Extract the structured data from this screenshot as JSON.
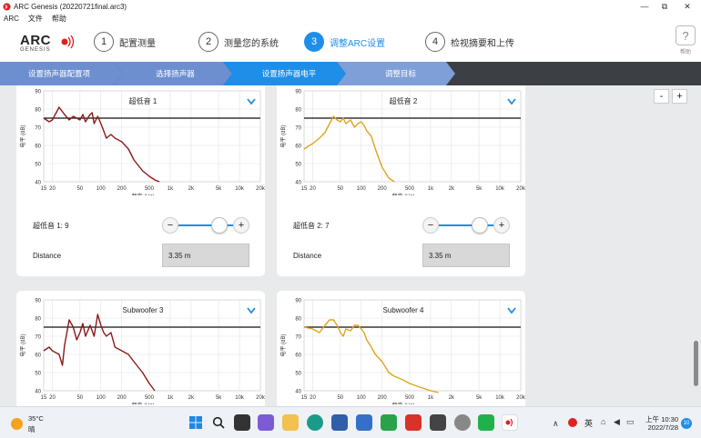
{
  "window": {
    "title": "ARC Genesis (20220721final.arc3)",
    "min": "—",
    "max": "⧉",
    "close": "✕"
  },
  "menu": [
    "ARC",
    "文件",
    "帮助"
  ],
  "logo": {
    "top": "ARC",
    "bottom": "GENESIS"
  },
  "steps": [
    {
      "num": "1",
      "label": "配置测量"
    },
    {
      "num": "2",
      "label": "测量您的系统"
    },
    {
      "num": "3",
      "label": "调整ARC设置"
    },
    {
      "num": "4",
      "label": "检视摘要和上传"
    }
  ],
  "help": {
    "icon": "?",
    "label": "帮助"
  },
  "substeps": [
    "设置扬声器配置项",
    "选择扬声器",
    "设置扬声器电平",
    "调整目标"
  ],
  "zoom": {
    "minus": "-",
    "plus": "+"
  },
  "axis": {
    "ylabel": "电平 (dB)",
    "xlabel": "频率 (Hz)",
    "yticks": [
      "90",
      "80",
      "70",
      "60",
      "50",
      "40"
    ],
    "xticks": [
      "15",
      "20",
      "50",
      "100",
      "200",
      "500",
      "1k",
      "2k",
      "5k",
      "10k",
      "20k"
    ]
  },
  "cards": [
    {
      "title": "超低音 1",
      "slider_label": "超低音 1: 9",
      "distance_label": "Distance",
      "distance_value": "3.35 m"
    },
    {
      "title": "超低音 2",
      "slider_label": "超低音 2: 7",
      "distance_label": "Distance",
      "distance_value": "3.35 m"
    },
    {
      "title": "Subwoofer 3"
    },
    {
      "title": "Subwoofer 4"
    }
  ],
  "slider": {
    "minus": "−",
    "plus": "+"
  },
  "chart_data": [
    {
      "type": "line",
      "title": "超低音 1",
      "xlabel": "频率 (Hz)",
      "ylabel": "电平 (dB)",
      "x_scale": "log",
      "xlim": [
        15,
        20000
      ],
      "ylim": [
        40,
        90
      ],
      "target_level": 75,
      "color": "#8b1a1a",
      "series": [
        {
          "x": [
            15,
            18,
            20,
            25,
            30,
            35,
            40,
            45,
            50,
            55,
            60,
            70,
            75,
            80,
            90,
            100,
            110,
            120,
            140,
            160,
            200,
            250,
            300,
            400,
            500,
            600,
            700
          ],
          "y": [
            75,
            73,
            74,
            81,
            77,
            74,
            76,
            75,
            74,
            77,
            73,
            77,
            78,
            72,
            76,
            72,
            68,
            64,
            66,
            64,
            62,
            58,
            52,
            46,
            43,
            41,
            40
          ]
        }
      ]
    },
    {
      "type": "line",
      "title": "超低音 2",
      "xlabel": "频率 (Hz)",
      "ylabel": "电平 (dB)",
      "x_scale": "log",
      "xlim": [
        15,
        20000
      ],
      "ylim": [
        40,
        90
      ],
      "target_level": 75,
      "color": "#e0a41c",
      "series": [
        {
          "x": [
            15,
            18,
            20,
            25,
            30,
            35,
            40,
            45,
            50,
            55,
            60,
            70,
            80,
            90,
            100,
            110,
            120,
            140,
            160,
            200,
            250,
            300
          ],
          "y": [
            58,
            60,
            61,
            64,
            67,
            72,
            76,
            74,
            73,
            75,
            72,
            74,
            70,
            72,
            73,
            71,
            68,
            65,
            58,
            48,
            42,
            40
          ]
        }
      ]
    },
    {
      "type": "line",
      "title": "Subwoofer 3",
      "xlabel": "频率 (Hz)",
      "ylabel": "电平 (dB)",
      "x_scale": "log",
      "xlim": [
        15,
        20000
      ],
      "ylim": [
        40,
        90
      ],
      "target_level": 75,
      "color": "#8b1a1a",
      "series": [
        {
          "x": [
            15,
            18,
            20,
            25,
            28,
            30,
            35,
            40,
            45,
            50,
            55,
            60,
            70,
            80,
            90,
            100,
            110,
            120,
            140,
            160,
            200,
            250,
            300,
            400,
            500,
            600
          ],
          "y": [
            62,
            64,
            62,
            60,
            54,
            65,
            79,
            75,
            68,
            72,
            77,
            70,
            76,
            70,
            82,
            76,
            72,
            70,
            72,
            64,
            62,
            60,
            56,
            50,
            44,
            40
          ]
        }
      ]
    },
    {
      "type": "line",
      "title": "Subwoofer 4",
      "xlabel": "频率 (Hz)",
      "ylabel": "电平 (dB)",
      "x_scale": "log",
      "xlim": [
        15,
        20000
      ],
      "ylim": [
        40,
        90
      ],
      "target_level": 75,
      "color": "#e0a41c",
      "series": [
        {
          "x": [
            15,
            20,
            25,
            30,
            35,
            40,
            45,
            50,
            55,
            60,
            70,
            80,
            90,
            100,
            110,
            120,
            140,
            160,
            200,
            250,
            300,
            400,
            500,
            700,
            1000,
            1300
          ],
          "y": [
            75,
            74,
            72,
            76,
            79,
            79,
            76,
            72,
            70,
            74,
            73,
            76,
            76,
            74,
            72,
            68,
            64,
            60,
            56,
            50,
            48,
            46,
            44,
            42,
            40,
            39
          ]
        }
      ]
    }
  ],
  "taskbar": {
    "temperature": "35°C",
    "weather": "晴",
    "ime": "英",
    "time": "上午 10:30",
    "date": "2022/7/28",
    "badge": "10"
  }
}
